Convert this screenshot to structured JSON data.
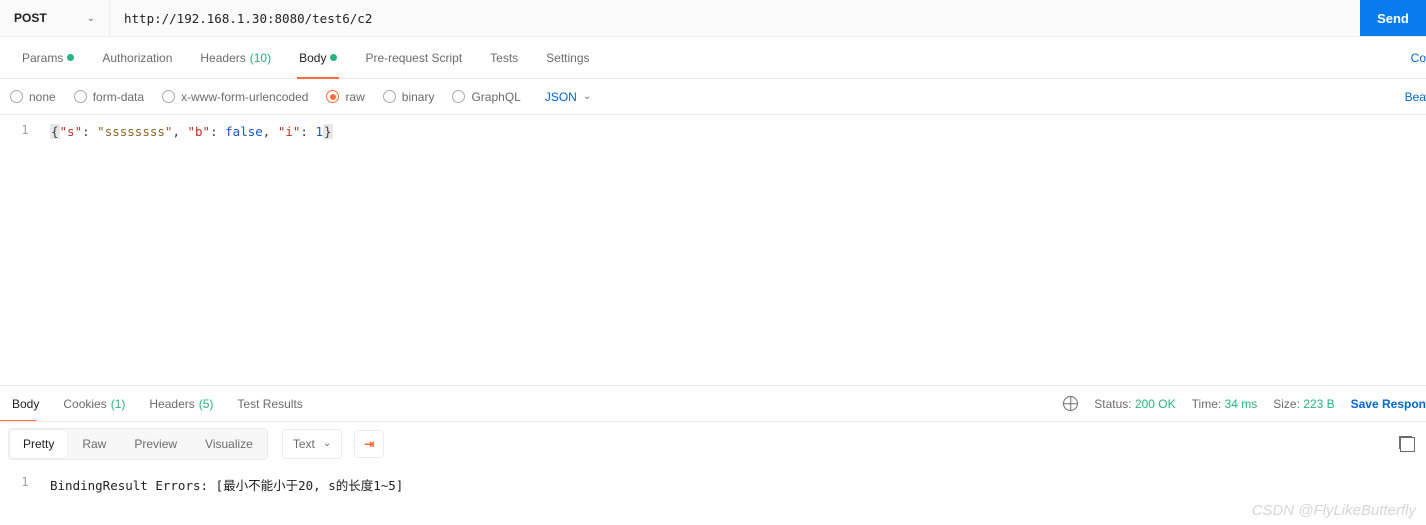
{
  "request": {
    "method": "POST",
    "url": "http://192.168.1.30:8080/test6/c2",
    "send_label": "Send"
  },
  "tabs": {
    "items": [
      {
        "label": "Params",
        "has_dot": true
      },
      {
        "label": "Authorization"
      },
      {
        "label": "Headers",
        "count": "(10)"
      },
      {
        "label": "Body",
        "has_dot": true,
        "active": true
      },
      {
        "label": "Pre-request Script"
      },
      {
        "label": "Tests"
      },
      {
        "label": "Settings"
      }
    ],
    "right_link": "Co"
  },
  "body_types": {
    "items": [
      {
        "label": "none"
      },
      {
        "label": "form-data"
      },
      {
        "label": "x-www-form-urlencoded"
      },
      {
        "label": "raw",
        "selected": true
      },
      {
        "label": "binary"
      },
      {
        "label": "GraphQL"
      }
    ],
    "format": "JSON",
    "right_link": "Bea"
  },
  "editor": {
    "line_no": "1",
    "tokens": {
      "open": "{",
      "k1": "\"s\"",
      "v1": "\"ssssssss\"",
      "k2": "\"b\"",
      "v2": "false",
      "k3": "\"i\"",
      "v3": "1",
      "close": "}",
      "colon": ":",
      "comma": ","
    }
  },
  "response_tabs": {
    "items": [
      {
        "label": "Body",
        "active": true
      },
      {
        "label": "Cookies",
        "count": "(1)"
      },
      {
        "label": "Headers",
        "count": "(5)"
      },
      {
        "label": "Test Results"
      }
    ]
  },
  "response_meta": {
    "status_label": "Status:",
    "status_value": "200 OK",
    "time_label": "Time:",
    "time_value": "34 ms",
    "size_label": "Size:",
    "size_value": "223 B",
    "save_label": "Save Respon"
  },
  "format_bar": {
    "segments": [
      {
        "label": "Pretty",
        "active": true
      },
      {
        "label": "Raw"
      },
      {
        "label": "Preview"
      },
      {
        "label": "Visualize"
      }
    ],
    "mode": "Text"
  },
  "response_body": {
    "line_no": "1",
    "text": "BindingResult Errors: [最小不能小于20, s的长度1~5]"
  },
  "watermark": "CSDN @FlyLikeButterfly"
}
